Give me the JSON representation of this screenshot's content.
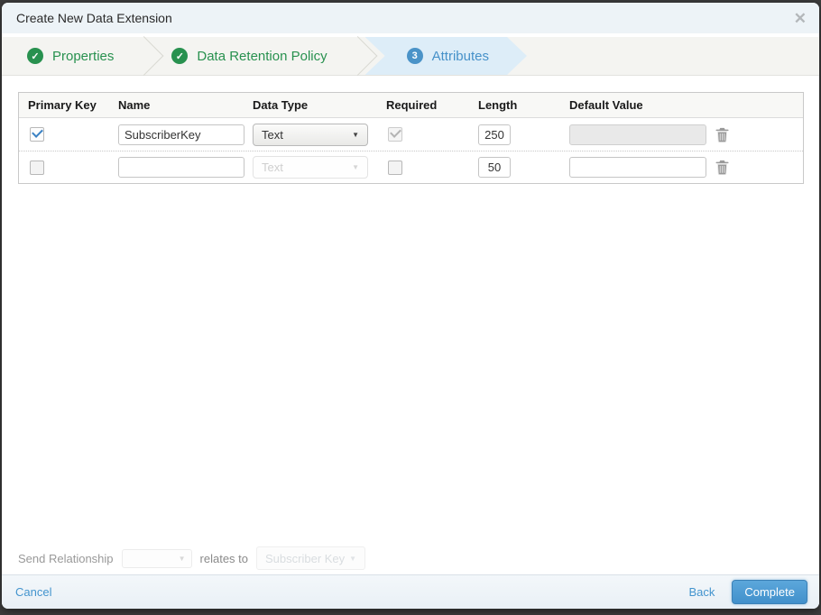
{
  "modal": {
    "title": "Create New Data Extension",
    "close_icon": "✕"
  },
  "wizard": {
    "steps": [
      {
        "label": "Properties",
        "status": "complete",
        "badge": "✓"
      },
      {
        "label": "Data Retention Policy",
        "status": "complete",
        "badge": "✓"
      },
      {
        "label": "Attributes",
        "status": "active",
        "badge": "3"
      }
    ]
  },
  "table": {
    "headers": [
      "Primary Key",
      "Name",
      "Data Type",
      "Required",
      "Length",
      "Default Value",
      ""
    ],
    "rows": [
      {
        "primary_key": true,
        "primary_key_locked": false,
        "name": "SubscriberKey",
        "data_type": "Text",
        "data_type_locked": false,
        "required": true,
        "required_locked": true,
        "length": "250",
        "default_value": "",
        "default_value_locked": true
      },
      {
        "primary_key": false,
        "primary_key_locked": false,
        "name": "",
        "data_type": "Text",
        "data_type_locked": true,
        "required": false,
        "required_locked": false,
        "length": "50",
        "default_value": "",
        "default_value_locked": false
      }
    ],
    "select_caret": "▼"
  },
  "send_relationship": {
    "label": "Send Relationship",
    "dropdown_value": "",
    "relates_to_label": "relates to",
    "target_field_label": "Subscriber Key",
    "caret": "▼"
  },
  "footer": {
    "cancel_label": "Cancel",
    "back_label": "Back",
    "complete_label": "Complete"
  },
  "colors": {
    "step_complete_green": "#28914f",
    "step_active_blue": "#4691c9",
    "step_active_bg": "#ddedf8",
    "titlebar_bg": "#edf3f7",
    "link_blue": "#4394ce",
    "primary_button_blue": "#4190cb",
    "checkbox_check_blue": "#3b82c4",
    "backdrop": "#3d3d3d"
  }
}
